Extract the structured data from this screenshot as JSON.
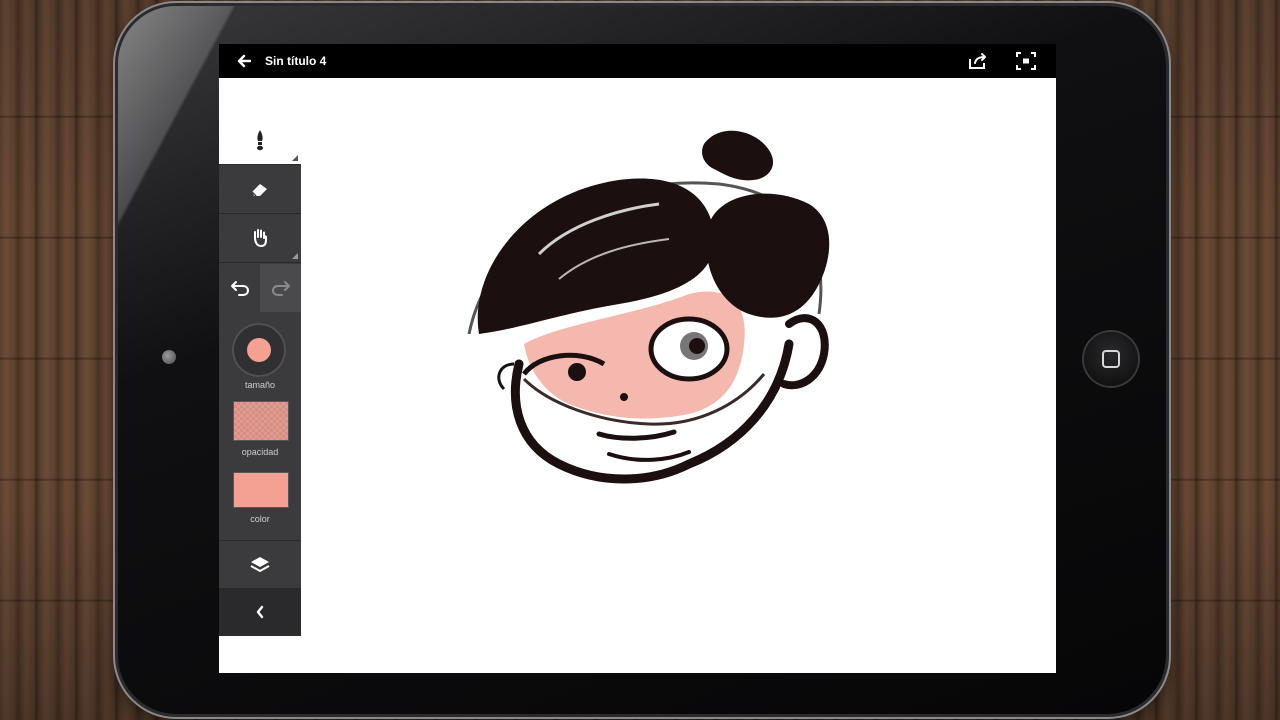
{
  "app": {
    "document_title": "Sin título 4"
  },
  "toolbar": {
    "size_label": "tamaño",
    "opacity_label": "opacidad",
    "color_label": "color",
    "brush_color": "#f4a194"
  },
  "colors": {
    "topbar": "#000000",
    "toolbar": "#3b3b3d",
    "canvas": "#ffffff",
    "ink": "#1b0f0f",
    "skin": "#f4b0a6"
  }
}
